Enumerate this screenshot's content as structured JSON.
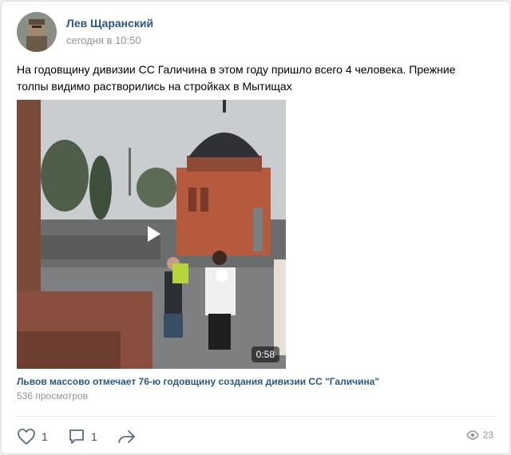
{
  "post": {
    "author": "Лев Щаранский",
    "time": "сегодня в 10:50",
    "text": "На годовщину дивизии СС Галичина в этом году пришло всего 4 человека. Прежние толпы видимо растворились на стройках в Мытищах"
  },
  "video": {
    "duration": "0:58",
    "title": "Львов массово отмечает 76-ю годовщину создания дивизии СС \"Галичина\"",
    "views": "536 просмотров"
  },
  "actions": {
    "likes": "1",
    "comments": "1",
    "views": "23"
  },
  "colors": {
    "link": "#2a5885",
    "muted": "#939393",
    "icon": "#5a6d84"
  }
}
